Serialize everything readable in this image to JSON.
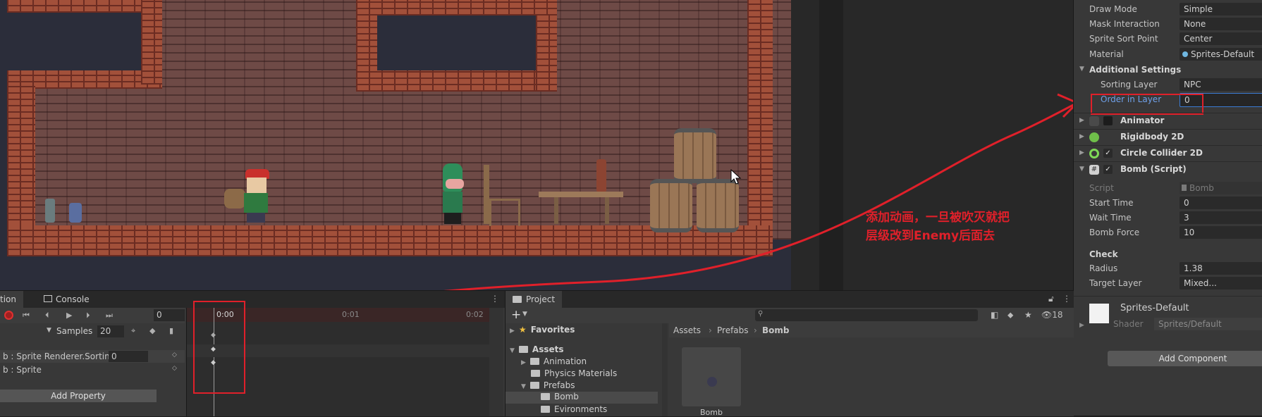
{
  "inspector": {
    "draw_mode": {
      "label": "Draw Mode",
      "value": "Simple"
    },
    "mask_interaction": {
      "label": "Mask Interaction",
      "value": "None"
    },
    "sprite_sort_point": {
      "label": "Sprite Sort Point",
      "value": "Center"
    },
    "material": {
      "label": "Material",
      "value": "Sprites-Default"
    },
    "additional_settings": "Additional Settings",
    "sorting_layer": {
      "label": "Sorting Layer",
      "value": "NPC"
    },
    "order_in_layer": {
      "label": "Order in Layer",
      "value": "0"
    },
    "components": [
      {
        "name": "Animator"
      },
      {
        "name": "Rigidbody 2D"
      },
      {
        "name": "Circle Collider 2D"
      },
      {
        "name": "Bomb (Script)"
      }
    ],
    "script": {
      "label": "Script",
      "value": "Bomb"
    },
    "start_time": {
      "label": "Start Time",
      "value": "0"
    },
    "wait_time": {
      "label": "Wait Time",
      "value": "3"
    },
    "bomb_force": {
      "label": "Bomb Force",
      "value": "10"
    },
    "check_header": "Check",
    "radius": {
      "label": "Radius",
      "value": "1.38"
    },
    "target_layer": {
      "label": "Target Layer",
      "value": "Mixed..."
    },
    "material_asset": {
      "name": "Sprites-Default",
      "shader_label": "Shader",
      "shader_value": "Sprites/Default"
    },
    "add_component": "Add Component"
  },
  "annotation": {
    "line1": "添加动画，一旦被吹灭就把",
    "line2": "层级改到Enemy后面去",
    "color": "#e0202a"
  },
  "animation": {
    "tab_label": "tion",
    "console_tab": "Console",
    "frame": "0",
    "samples_label": "Samples",
    "samples_value": "20",
    "properties": [
      {
        "label": "b : Sprite Renderer.Sorting",
        "value": "0"
      },
      {
        "label": "b : Sprite",
        "value": ""
      }
    ],
    "add_property": "Add Property",
    "time_labels": [
      "0:00",
      "0:01",
      "0:02"
    ]
  },
  "project": {
    "tab_label": "Project",
    "count": "18",
    "favorites": "Favorites",
    "assets": "Assets",
    "folders": [
      "Animation",
      "Physics Materials",
      "Prefabs",
      "Bomb",
      "Evironments"
    ],
    "breadcrumb": [
      "Assets",
      "Prefabs",
      "Bomb"
    ],
    "asset_item": "Bomb"
  },
  "colors": {
    "accent_red": "#e0202a",
    "field_blue": "#3a7bd5"
  }
}
